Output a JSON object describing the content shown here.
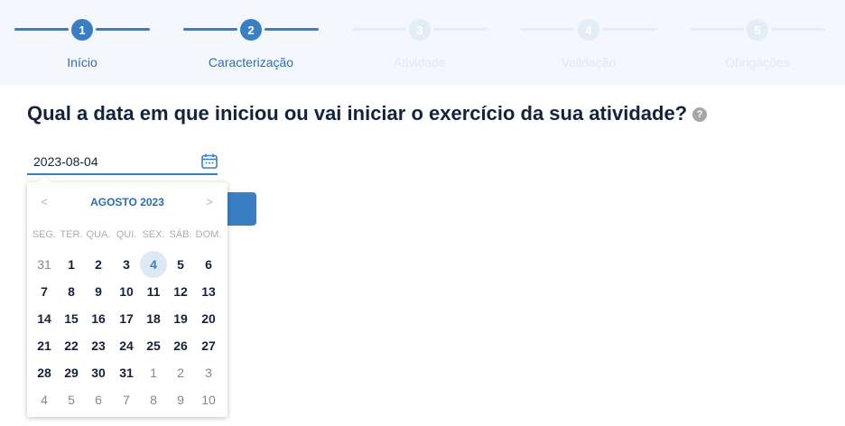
{
  "stepper": {
    "steps": [
      {
        "number": "1",
        "label": "Início",
        "state": "active"
      },
      {
        "number": "2",
        "label": "Caracterização",
        "state": "active"
      },
      {
        "number": "3",
        "label": "Atividade",
        "state": "inactive"
      },
      {
        "number": "4",
        "label": "Validação",
        "state": "inactive"
      },
      {
        "number": "5",
        "label": "Obrigações",
        "state": "inactive"
      }
    ]
  },
  "question": {
    "text": "Qual a data em que iniciou ou vai iniciar o exercício da sua atividade?",
    "help_icon": "?"
  },
  "date_input": {
    "value": "2023-08-04",
    "icon": "calendar-icon"
  },
  "calendar": {
    "prev": "<",
    "next": ">",
    "title": "AGOSTO 2023",
    "weekdays": [
      "SEG.",
      "TER.",
      "QUA.",
      "QUI.",
      "SEX.",
      "SÁB.",
      "DOM."
    ],
    "weeks": [
      [
        "31",
        "1",
        "2",
        "3",
        "4",
        "5",
        "6"
      ],
      [
        "7",
        "8",
        "9",
        "10",
        "11",
        "12",
        "13"
      ],
      [
        "14",
        "15",
        "16",
        "17",
        "18",
        "19",
        "20"
      ],
      [
        "21",
        "22",
        "23",
        "24",
        "25",
        "26",
        "27"
      ],
      [
        "28",
        "29",
        "30",
        "31",
        "1",
        "2",
        "3"
      ],
      [
        "4",
        "5",
        "6",
        "7",
        "8",
        "9",
        "10"
      ]
    ],
    "selected_day": "4"
  },
  "colors": {
    "accent": "#3a7fc4",
    "heading": "#14233c",
    "inactive_step": "#e3edf6"
  }
}
